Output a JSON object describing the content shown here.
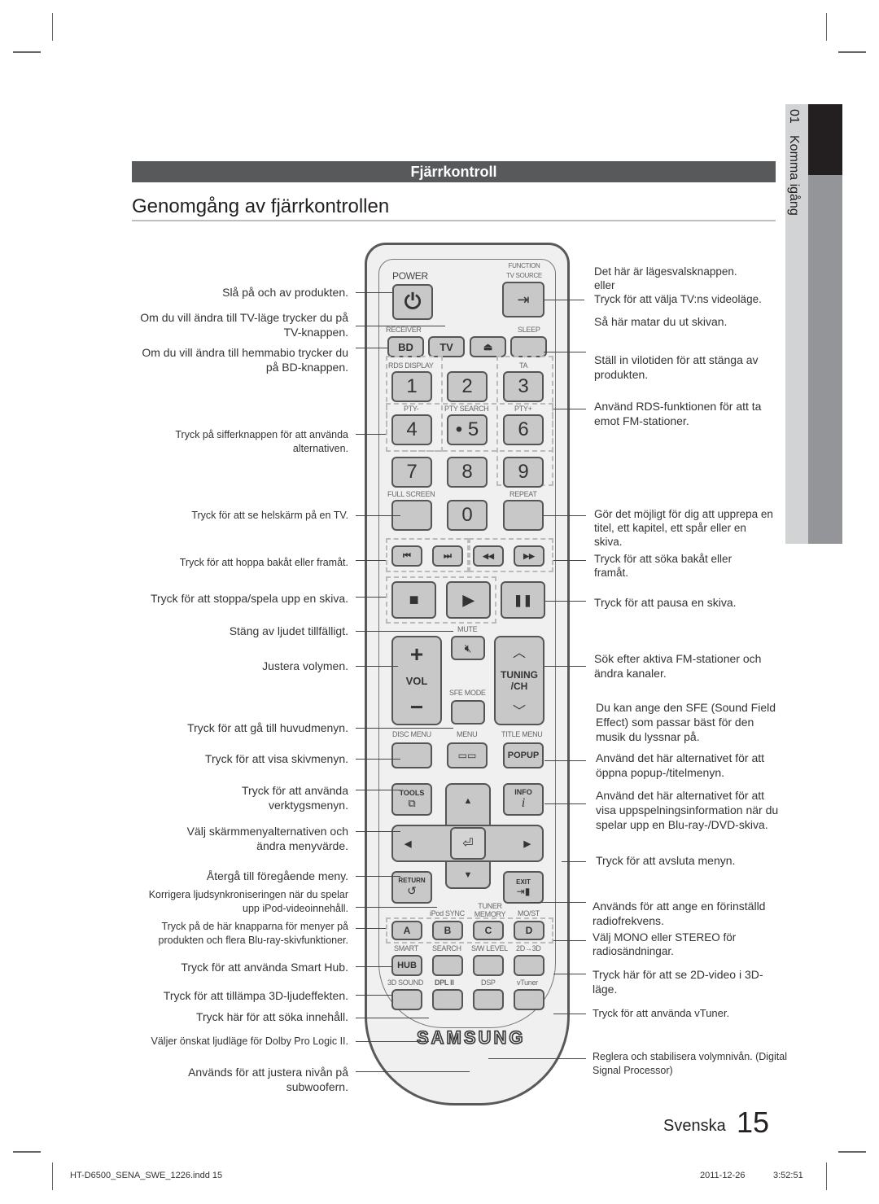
{
  "section": {
    "header": "Fjärrkontroll",
    "title": "Genomgång av fjärrkontrollen"
  },
  "side_tab": {
    "number": "01",
    "label": "Komma igång"
  },
  "remote": {
    "power_label": "POWER",
    "function_label": "FUNCTION",
    "tvsource_label": "TV SOURCE",
    "receiver_label": "RECEIVER",
    "sleep_label": "SLEEP",
    "bd": "BD",
    "tv": "TV",
    "eject_icon": "⏏",
    "rds_display": "RDS DISPLAY",
    "ta": "TA",
    "pty_minus": "PTY-",
    "pty_search": "PTY SEARCH",
    "pty_plus": "PTY+",
    "digits": [
      "1",
      "2",
      "3",
      "4",
      "• 5",
      "6",
      "7",
      "8",
      "9",
      "0"
    ],
    "full_screen": "FULL SCREEN",
    "repeat": "REPEAT",
    "skip_back": "⏮",
    "skip_fwd": "⏭",
    "rewind": "◀◀",
    "ffwd": "▶▶",
    "stop": "■",
    "play": "▶",
    "pause": "❚❚",
    "mute_label": "MUTE",
    "vol_plus": "+",
    "vol": "VOL",
    "vol_minus": "−",
    "tuning": "TUNING",
    "ch": "/CH",
    "sfe_mode": "SFE MODE",
    "disc_menu": "DISC MENU",
    "menu": "MENU",
    "title_menu": "TITLE MENU",
    "popup": "POPUP",
    "tools": "TOOLS",
    "info": "INFO",
    "info_i": "i",
    "return": "RETURN",
    "exit": "EXIT",
    "ipod_sync": "iPod SYNC",
    "tuner_memory": "TUNER MEMORY",
    "mo_st": "MO/ST",
    "abcd": [
      "A",
      "B",
      "C",
      "D"
    ],
    "smart": "SMART",
    "search": "SEARCH",
    "sw_level": "S/W LEVEL",
    "2d3d": "2D→3D",
    "hub": "HUB",
    "sound3d": "3D SOUND",
    "dplii": "DPL II",
    "dsp": "DSP",
    "vtuner": "vTuner",
    "brand": "SAMSUNG"
  },
  "left_notes": [
    "Slå på och av produkten.",
    "Om du vill ändra till TV-läge trycker du på TV-knappen.",
    "Om du vill ändra till hemmabio trycker du på BD-knappen.",
    "Tryck på sifferknappen för att använda alternativen.",
    "Tryck för att se helskärm på en TV.",
    "Tryck för att hoppa bakåt eller framåt.",
    "Tryck för att stoppa/spela upp en skiva.",
    "Stäng av ljudet tillfälligt.",
    "Justera volymen.",
    "Tryck för att gå till huvudmenyn.",
    "Tryck för att visa skivmenyn.",
    "Tryck för att använda verktygsmenyn.",
    "Välj skärmmenyalternativen och ändra menyvärde.",
    "Återgå till föregående meny.",
    "Korrigera ljudsynkroniseringen när du spelar upp iPod-videoinnehåll.",
    "Tryck på de här knapparna för menyer på produkten och flera Blu-ray-skivfunktioner.",
    "Tryck för att använda Smart Hub.",
    "Tryck för att tillämpa 3D-ljudeffekten.",
    "Tryck här för att söka innehåll.",
    "Väljer önskat ljudläge för Dolby Pro Logic II.",
    "Används för att justera nivån på subwoofern."
  ],
  "right_notes": [
    "Det här är lägesvalsknappen.\neller\nTryck för att välja TV:ns videoläge.",
    "Så här matar du ut skivan.",
    "Ställ in vilotiden för att stänga av produkten.",
    "Använd RDS-funktionen för att ta emot FM-stationer.",
    "Gör det möjligt för dig att upprepa en titel, ett kapitel, ett spår eller en skiva.",
    "Tryck för att söka bakåt eller framåt.",
    "Tryck för att pausa en skiva.",
    "Sök efter aktiva FM-stationer och ändra kanaler.",
    "Du kan ange den SFE (Sound Field Effect) som passar bäst för den musik du lyssnar på.",
    "Använd det här alternativet för att öppna popup-/titelmenyn.",
    "Använd det här alternativet för att visa uppspelningsinformation när du spelar upp en Blu-ray-/DVD-skiva.",
    "Tryck för att avsluta menyn.",
    "Används för att ange en förinställd radiofrekvens.",
    "Välj MONO eller STEREO för radiosändningar.",
    "Tryck här för att se 2D-video i 3D-läge.",
    "Tryck för att använda vTuner.",
    "Reglera och stabilisera volymnivån. (Digital Signal Processor)"
  ],
  "page": {
    "language": "Svenska",
    "number": "15"
  },
  "footer": {
    "file": "HT-D6500_SENA_SWE_1226.indd   15",
    "date": "2011-12-26",
    "time": "3:52:51"
  }
}
